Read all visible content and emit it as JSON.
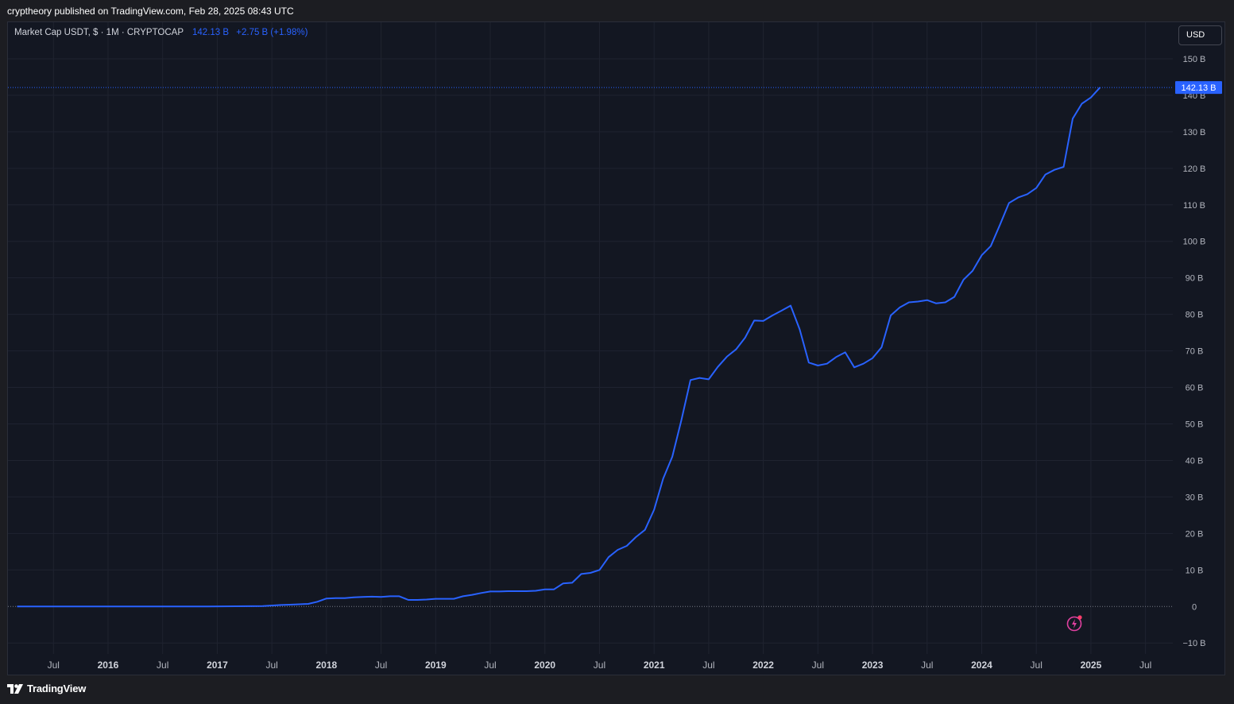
{
  "header": {
    "published": "cryptheory published on TradingView.com, Feb 28, 2025 08:43 UTC"
  },
  "legend": {
    "symbol": "Market Cap USDT, $ · 1M · CRYPTOCAP",
    "value": "142.13 B",
    "change": "+2.75 B (+1.98%)"
  },
  "currency": "USD",
  "price_label": "142.13 B",
  "footer": {
    "brand": "TradingView",
    "logo_icon": "tradingview-logo-icon"
  },
  "colors": {
    "line": "#2962ff",
    "background": "#131722",
    "grid": "#1f2330",
    "text": "#b2b5be"
  },
  "chart_data": {
    "type": "line",
    "title": "Market Cap USDT, $ · 1M · CRYPTOCAP",
    "xlabel": "",
    "ylabel": "",
    "x_unit": "month",
    "xlim": [
      "2015-02",
      "2025-10"
    ],
    "ylim": [
      -13,
      160
    ],
    "grid": true,
    "legend": "top-left",
    "y_ticks": [
      {
        "value": 150,
        "label": "150 B"
      },
      {
        "value": 140,
        "label": "140 B"
      },
      {
        "value": 130,
        "label": "130 B"
      },
      {
        "value": 120,
        "label": "120 B"
      },
      {
        "value": 110,
        "label": "110 B"
      },
      {
        "value": 100,
        "label": "100 B"
      },
      {
        "value": 90,
        "label": "90 B"
      },
      {
        "value": 80,
        "label": "80 B"
      },
      {
        "value": 70,
        "label": "70 B"
      },
      {
        "value": 60,
        "label": "60 B"
      },
      {
        "value": 50,
        "label": "50 B"
      },
      {
        "value": 40,
        "label": "40 B"
      },
      {
        "value": 30,
        "label": "30 B"
      },
      {
        "value": 20,
        "label": "20 B"
      },
      {
        "value": 10,
        "label": "10 B"
      },
      {
        "value": 0,
        "label": "0"
      },
      {
        "value": -10,
        "label": "−10 B"
      }
    ],
    "x_ticks": [
      {
        "x": "2015-07",
        "label": "Jul",
        "bold": false
      },
      {
        "x": "2016-01",
        "label": "2016",
        "bold": true
      },
      {
        "x": "2016-07",
        "label": "Jul",
        "bold": false
      },
      {
        "x": "2017-01",
        "label": "2017",
        "bold": true
      },
      {
        "x": "2017-07",
        "label": "Jul",
        "bold": false
      },
      {
        "x": "2018-01",
        "label": "2018",
        "bold": true
      },
      {
        "x": "2018-07",
        "label": "Jul",
        "bold": false
      },
      {
        "x": "2019-01",
        "label": "2019",
        "bold": true
      },
      {
        "x": "2019-07",
        "label": "Jul",
        "bold": false
      },
      {
        "x": "2020-01",
        "label": "2020",
        "bold": true
      },
      {
        "x": "2020-07",
        "label": "Jul",
        "bold": false
      },
      {
        "x": "2021-01",
        "label": "2021",
        "bold": true
      },
      {
        "x": "2021-07",
        "label": "Jul",
        "bold": false
      },
      {
        "x": "2022-01",
        "label": "2022",
        "bold": true
      },
      {
        "x": "2022-07",
        "label": "Jul",
        "bold": false
      },
      {
        "x": "2023-01",
        "label": "2023",
        "bold": true
      },
      {
        "x": "2023-07",
        "label": "Jul",
        "bold": false
      },
      {
        "x": "2024-01",
        "label": "2024",
        "bold": true
      },
      {
        "x": "2024-07",
        "label": "Jul",
        "bold": false
      },
      {
        "x": "2025-01",
        "label": "2025",
        "bold": true
      },
      {
        "x": "2025-07",
        "label": "Jul",
        "bold": false
      }
    ],
    "last_value": 142.13,
    "series": [
      {
        "color": "#2962ff",
        "points": [
          [
            "2015-03",
            0.0
          ],
          [
            "2015-06",
            0.0
          ],
          [
            "2015-09",
            0.0
          ],
          [
            "2015-12",
            0.0
          ],
          [
            "2016-03",
            0.0
          ],
          [
            "2016-06",
            0.0
          ],
          [
            "2016-09",
            0.0
          ],
          [
            "2016-12",
            0.0
          ],
          [
            "2017-03",
            0.05
          ],
          [
            "2017-06",
            0.1
          ],
          [
            "2017-08",
            0.4
          ],
          [
            "2017-09",
            0.5
          ],
          [
            "2017-10",
            0.6
          ],
          [
            "2017-11",
            0.7
          ],
          [
            "2017-12",
            1.3
          ],
          [
            "2018-01",
            2.2
          ],
          [
            "2018-02",
            2.3
          ],
          [
            "2018-03",
            2.3
          ],
          [
            "2018-04",
            2.5
          ],
          [
            "2018-05",
            2.6
          ],
          [
            "2018-06",
            2.7
          ],
          [
            "2018-07",
            2.6
          ],
          [
            "2018-08",
            2.8
          ],
          [
            "2018-09",
            2.8
          ],
          [
            "2018-10",
            1.8
          ],
          [
            "2018-11",
            1.8
          ],
          [
            "2018-12",
            1.9
          ],
          [
            "2019-01",
            2.1
          ],
          [
            "2019-02",
            2.1
          ],
          [
            "2019-03",
            2.1
          ],
          [
            "2019-04",
            2.8
          ],
          [
            "2019-05",
            3.2
          ],
          [
            "2019-06",
            3.7
          ],
          [
            "2019-07",
            4.1
          ],
          [
            "2019-08",
            4.1
          ],
          [
            "2019-09",
            4.2
          ],
          [
            "2019-10",
            4.2
          ],
          [
            "2019-11",
            4.2
          ],
          [
            "2019-12",
            4.3
          ],
          [
            "2020-01",
            4.7
          ],
          [
            "2020-02",
            4.7
          ],
          [
            "2020-03",
            6.3
          ],
          [
            "2020-04",
            6.5
          ],
          [
            "2020-05",
            8.9
          ],
          [
            "2020-06",
            9.2
          ],
          [
            "2020-07",
            10.0
          ],
          [
            "2020-08",
            13.5
          ],
          [
            "2020-09",
            15.5
          ],
          [
            "2020-10",
            16.6
          ],
          [
            "2020-11",
            19.0
          ],
          [
            "2020-12",
            21.0
          ],
          [
            "2021-01",
            26.5
          ],
          [
            "2021-02",
            35.0
          ],
          [
            "2021-03",
            41.0
          ],
          [
            "2021-04",
            51.0
          ],
          [
            "2021-05",
            62.0
          ],
          [
            "2021-06",
            62.6
          ],
          [
            "2021-07",
            62.2
          ],
          [
            "2021-08",
            65.6
          ],
          [
            "2021-09",
            68.4
          ],
          [
            "2021-10",
            70.4
          ],
          [
            "2021-11",
            73.6
          ],
          [
            "2021-12",
            78.3
          ],
          [
            "2022-01",
            78.2
          ],
          [
            "2022-02",
            79.7
          ],
          [
            "2022-03",
            81.0
          ],
          [
            "2022-04",
            82.4
          ],
          [
            "2022-05",
            75.9
          ],
          [
            "2022-06",
            66.8
          ],
          [
            "2022-07",
            66.0
          ],
          [
            "2022-08",
            66.5
          ],
          [
            "2022-09",
            68.3
          ],
          [
            "2022-10",
            69.6
          ],
          [
            "2022-11",
            65.5
          ],
          [
            "2022-12",
            66.5
          ],
          [
            "2023-01",
            68.0
          ],
          [
            "2023-02",
            71.0
          ],
          [
            "2023-03",
            79.7
          ],
          [
            "2023-04",
            81.9
          ],
          [
            "2023-05",
            83.3
          ],
          [
            "2023-06",
            83.5
          ],
          [
            "2023-07",
            83.9
          ],
          [
            "2023-08",
            83.0
          ],
          [
            "2023-09",
            83.3
          ],
          [
            "2023-10",
            84.8
          ],
          [
            "2023-11",
            89.5
          ],
          [
            "2023-12",
            91.9
          ],
          [
            "2024-01",
            96.2
          ],
          [
            "2024-02",
            98.7
          ],
          [
            "2024-03",
            104.5
          ],
          [
            "2024-04",
            110.5
          ],
          [
            "2024-05",
            112.0
          ],
          [
            "2024-06",
            112.9
          ],
          [
            "2024-07",
            114.6
          ],
          [
            "2024-08",
            118.3
          ],
          [
            "2024-09",
            119.6
          ],
          [
            "2024-10",
            120.4
          ],
          [
            "2024-11",
            133.6
          ],
          [
            "2024-12",
            137.7
          ],
          [
            "2025-01",
            139.4
          ],
          [
            "2025-02",
            142.13
          ]
        ]
      }
    ]
  }
}
